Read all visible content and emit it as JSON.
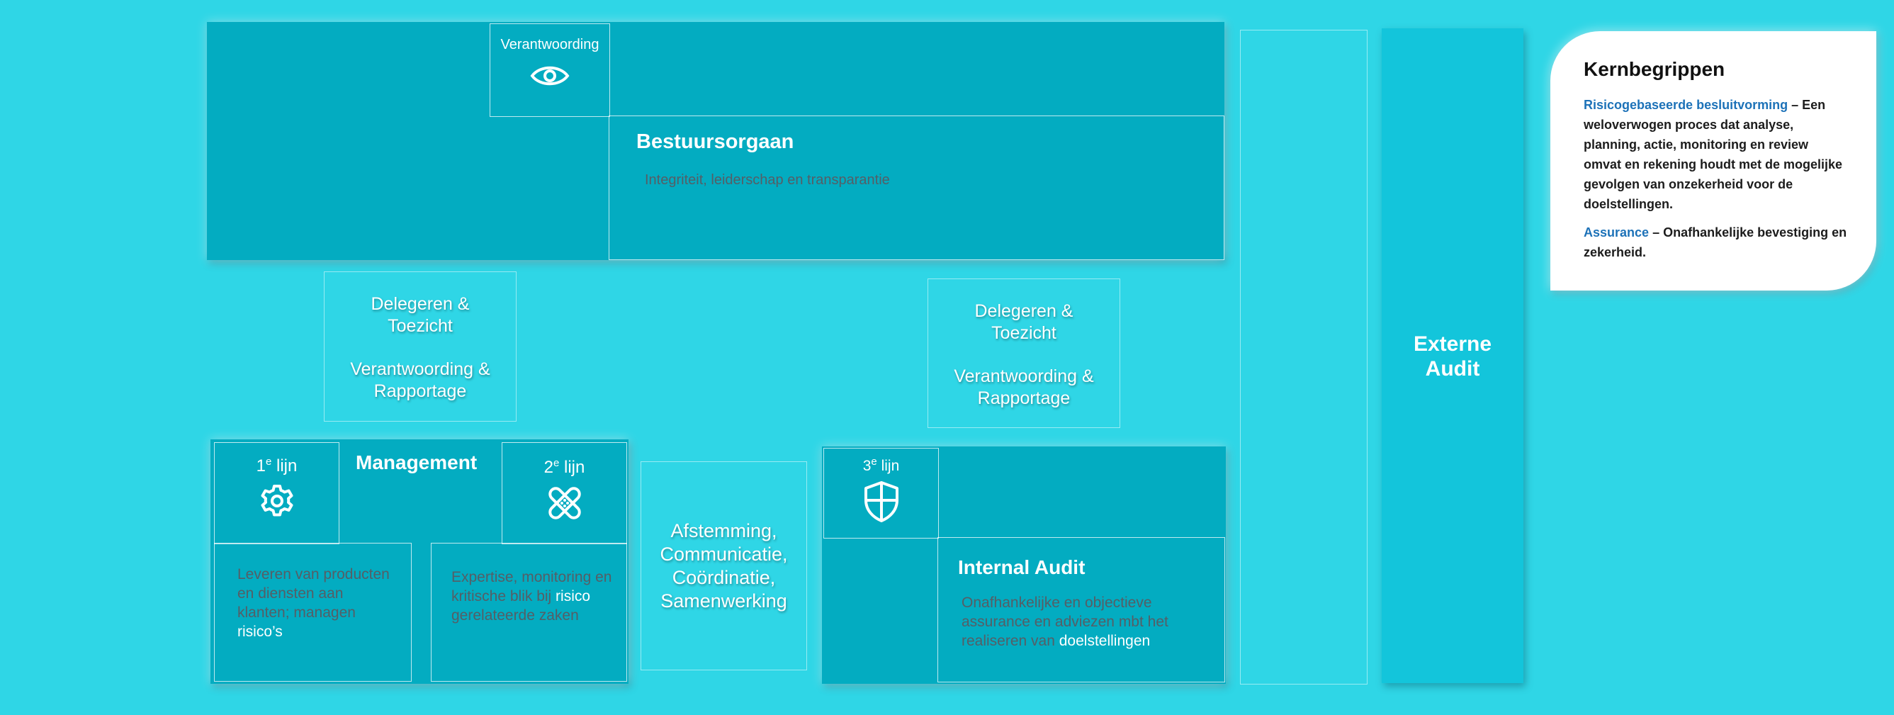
{
  "governing_body": {
    "tag": "Verantwoording",
    "tag_icon": "eye-icon",
    "title": "Bestuursorgaan",
    "subtitle": "Integriteit, leiderschap en transparantie"
  },
  "left_relation": {
    "line1": "Delegeren &",
    "line2": "Toezicht",
    "line3": "Verantwoording &",
    "line4": "Rapportage"
  },
  "right_relation": {
    "line1": "Delegeren &",
    "line2": "Toezicht",
    "line3": "Verantwoording &",
    "line4": "Rapportage"
  },
  "management": {
    "title": "Management",
    "first_line": {
      "num": "1",
      "sup": "e",
      "word": " lijn",
      "icon": "gear-icon"
    },
    "second_line": {
      "num": "2",
      "sup": "e",
      "word": " lijn",
      "icon": "bandage-icon"
    },
    "first_desc": {
      "part1": "Leveren van producten en diensten aan klanten; managen ",
      "part2": "risico’s"
    },
    "second_desc": {
      "part1": "Expertise, monitoring en kritische blik bij ",
      "part2": "risico",
      "part3": " gerelateerde zaken"
    }
  },
  "coordination": {
    "line1": "Afstemming,",
    "line2": "Communicatie,",
    "line3": "Coördinatie,",
    "line4": "Samenwerking"
  },
  "internal_audit": {
    "tag": {
      "num": "3",
      "sup": "e",
      "word": " lijn",
      "icon": "shield-icon"
    },
    "title": "Internal Audit",
    "desc": {
      "part1": "Onafhankelijke en objectieve assurance en adviezen mbt het realiseren van ",
      "part2": "doelstellingen"
    }
  },
  "external_audit": {
    "line1": "Externe",
    "line2": "Audit"
  },
  "key_concepts": {
    "title": "Kernbegrippen",
    "items": [
      {
        "term": "Risicogebaseerde besluitvorming",
        "text": " – Een weloverwogen proces dat analyse, planning, actie, monitoring en review omvat en rekening houdt met de mogelijke gevolgen van onzekerheid voor de doelstellingen."
      },
      {
        "term": "Assurance",
        "text": " – Onafhankelijke bevestiging en zekerheid."
      }
    ]
  },
  "colors": {
    "background": "#2fd6e6",
    "panel": "#03acc1",
    "external_audit": "#13c5db",
    "term_blue": "#1d72b8",
    "muted_text": "#555e66"
  }
}
